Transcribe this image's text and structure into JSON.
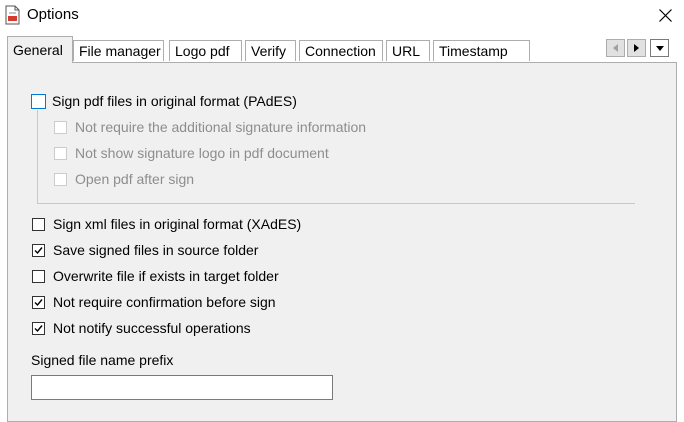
{
  "window": {
    "title": "Options"
  },
  "tabs": [
    {
      "label": "General"
    },
    {
      "label": "File manager"
    },
    {
      "label": "Logo pdf"
    },
    {
      "label": "Verify"
    },
    {
      "label": "Connection"
    },
    {
      "label": "URL"
    },
    {
      "label": "Timestamp"
    }
  ],
  "options": {
    "pades": {
      "label": "Sign pdf files in original format (PAdES)",
      "checked": false
    },
    "pades_sub": [
      {
        "label": "Not require the additional signature information",
        "checked": false,
        "enabled": false
      },
      {
        "label": "Not show signature logo in pdf document",
        "checked": false,
        "enabled": false
      },
      {
        "label": "Open pdf after sign",
        "checked": false,
        "enabled": false
      }
    ],
    "xades": {
      "label": "Sign xml files in original format (XAdES)",
      "checked": false
    },
    "save_source": {
      "label": "Save signed files in source folder",
      "checked": true
    },
    "overwrite": {
      "label": "Overwrite file if exists in target folder",
      "checked": false
    },
    "no_confirm": {
      "label": "Not require confirmation before sign",
      "checked": true
    },
    "no_notify": {
      "label": "Not notify successful operations",
      "checked": true
    }
  },
  "prefix": {
    "label": "Signed file name prefix",
    "value": ""
  },
  "icons": {
    "app": "pdf-document-icon",
    "close": "close-icon",
    "scroll_left": "triangle-left-icon",
    "scroll_right": "triangle-right-icon",
    "menu": "chevron-down-icon",
    "check": "check-icon"
  },
  "colors": {
    "focus_border": "#0078d7",
    "panel_bg": "#f0f0f0",
    "disabled_text": "#8d8d8d"
  }
}
